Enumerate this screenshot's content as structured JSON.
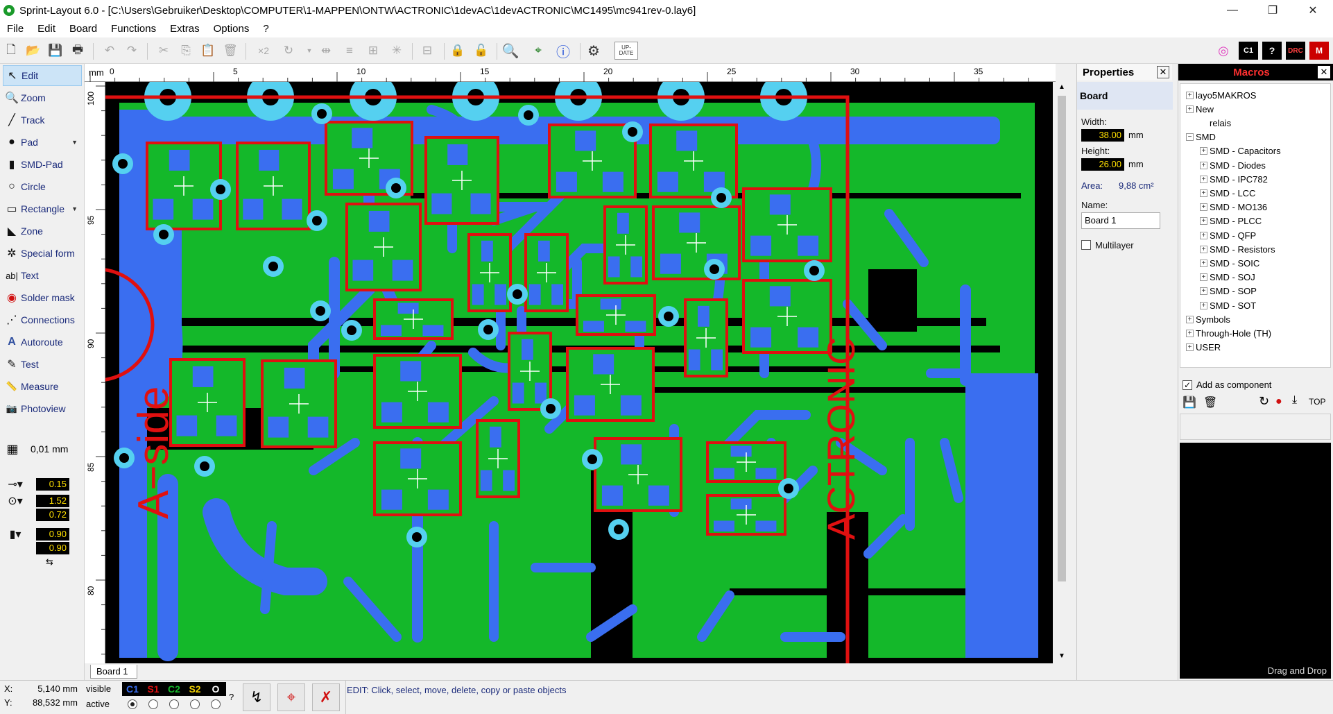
{
  "window": {
    "title": "Sprint-Layout 6.0 - [C:\\Users\\Gebruiker\\Desktop\\COMPUTER\\1-MAPPEN\\ONTW\\ACTRONIC\\1devAC\\1devACTRONIC\\MC1495\\mc941rev-0.lay6]",
    "minimize": "—",
    "restore": "❐",
    "close": "✕"
  },
  "menu": [
    "File",
    "Edit",
    "Board",
    "Functions",
    "Extras",
    "Options",
    "?"
  ],
  "toolbar": {
    "mirror_label": "×2",
    "update_label": "UP-DATE",
    "drc_label": "DRC"
  },
  "tools": [
    {
      "label": "Edit",
      "icon": "pointer-icon",
      "glyph": "↖"
    },
    {
      "label": "Zoom",
      "icon": "zoom-icon",
      "glyph": "🔍"
    },
    {
      "label": "Track",
      "icon": "track-icon",
      "glyph": "╱"
    },
    {
      "label": "Pad",
      "icon": "pad-icon",
      "glyph": "●"
    },
    {
      "label": "SMD-Pad",
      "icon": "smd-pad-icon",
      "glyph": "▮"
    },
    {
      "label": "Circle",
      "icon": "circle-icon",
      "glyph": "○"
    },
    {
      "label": "Rectangle",
      "icon": "rectangle-icon",
      "glyph": "▭"
    },
    {
      "label": "Zone",
      "icon": "zone-icon",
      "glyph": "◣"
    },
    {
      "label": "Special form",
      "icon": "special-form-icon",
      "glyph": "✲"
    },
    {
      "label": "Text",
      "icon": "text-icon",
      "glyph": "ab|"
    },
    {
      "label": "Solder mask",
      "icon": "solder-mask-icon",
      "glyph": "◉"
    },
    {
      "label": "Connections",
      "icon": "connections-icon",
      "glyph": "⋰"
    },
    {
      "label": "Autoroute",
      "icon": "autoroute-icon",
      "glyph": "A"
    },
    {
      "label": "Test",
      "icon": "test-icon",
      "glyph": "✎"
    },
    {
      "label": "Measure",
      "icon": "measure-icon",
      "glyph": "📏"
    },
    {
      "label": "Photoview",
      "icon": "photoview-icon",
      "glyph": "📷"
    }
  ],
  "grid": {
    "value": "0,01 mm"
  },
  "values": {
    "track_width": "0.15",
    "pad_outer": "1.52",
    "pad_inner": "0.72",
    "smd_w": "0.90",
    "smd_h": "0.90"
  },
  "ruler": {
    "unit": "mm",
    "top_ticks": [
      "0",
      "5",
      "10",
      "15",
      "20",
      "25",
      "30",
      "35"
    ],
    "left_ticks": [
      "100",
      "95",
      "90",
      "85",
      "80"
    ]
  },
  "board": {
    "text_left": "A−side",
    "text_right": "ACTRONIC",
    "colors": {
      "background": "#000000",
      "copper_top": "#3a6ef0",
      "copper_bottom": "#14b82a",
      "outline": "#e01010",
      "pad_ring": "#55d0f0"
    }
  },
  "sheet_tab": "Board 1",
  "properties": {
    "title": "Properties",
    "section": "Board",
    "width_label": "Width:",
    "width_value": "38.00",
    "height_label": "Height:",
    "height_value": "26.00",
    "unit": "mm",
    "area_label": "Area:",
    "area_value": "9,88 cm²",
    "name_label": "Name:",
    "name_value": "Board 1",
    "multilayer_label": "Multilayer"
  },
  "macros": {
    "title": "Macros",
    "tree": [
      {
        "label": "layo5MAKROS",
        "level": 0,
        "exp": "+"
      },
      {
        "label": "New",
        "level": 0,
        "exp": "+"
      },
      {
        "label": "relais",
        "level": 1,
        "exp": ""
      },
      {
        "label": "SMD",
        "level": 0,
        "exp": "−"
      },
      {
        "label": "SMD - Capacitors",
        "level": 1,
        "exp": "+"
      },
      {
        "label": "SMD - Diodes",
        "level": 1,
        "exp": "+"
      },
      {
        "label": "SMD - IPC782",
        "level": 1,
        "exp": "+"
      },
      {
        "label": "SMD - LCC",
        "level": 1,
        "exp": "+"
      },
      {
        "label": "SMD - MO136",
        "level": 1,
        "exp": "+"
      },
      {
        "label": "SMD - PLCC",
        "level": 1,
        "exp": "+"
      },
      {
        "label": "SMD - QFP",
        "level": 1,
        "exp": "+"
      },
      {
        "label": "SMD - Resistors",
        "level": 1,
        "exp": "+"
      },
      {
        "label": "SMD - SOIC",
        "level": 1,
        "exp": "+"
      },
      {
        "label": "SMD - SOJ",
        "level": 1,
        "exp": "+"
      },
      {
        "label": "SMD - SOP",
        "level": 1,
        "exp": "+"
      },
      {
        "label": "SMD - SOT",
        "level": 1,
        "exp": "+"
      },
      {
        "label": "Symbols",
        "level": 0,
        "exp": "+"
      },
      {
        "label": "Through-Hole (TH)",
        "level": 0,
        "exp": "+"
      },
      {
        "label": "USER",
        "level": 0,
        "exp": "+"
      }
    ],
    "add_as_component": "Add as component",
    "top_label": "TOP",
    "drag_drop": "Drag and Drop"
  },
  "status": {
    "x_label": "X:",
    "x_value": "5,140 mm",
    "y_label": "Y:",
    "y_value": "88,532 mm",
    "visible_label": "visible",
    "active_label": "active",
    "layers": [
      {
        "name": "C1",
        "color": "#3a6ef0"
      },
      {
        "name": "S1",
        "color": "#e01010"
      },
      {
        "name": "C2",
        "color": "#14b82a"
      },
      {
        "name": "S2",
        "color": "#f0d000"
      },
      {
        "name": "O",
        "color": "#ffffff"
      }
    ],
    "help": "?",
    "message": "EDIT:  Click, select, move, delete, copy or paste objects"
  }
}
